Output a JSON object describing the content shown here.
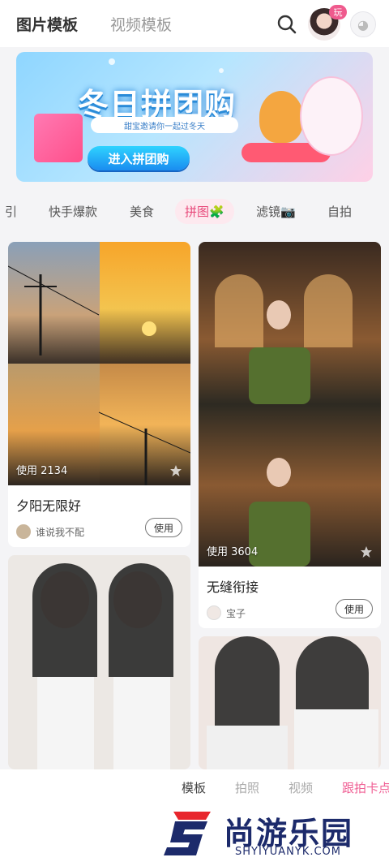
{
  "header": {
    "tabs": [
      {
        "label": "图片模板",
        "active": true
      },
      {
        "label": "视频模板",
        "active": false
      }
    ],
    "avatar_badge": "玩",
    "icons": [
      "search-icon",
      "avatar",
      "mascot-icon"
    ]
  },
  "banner": {
    "title": "冬日拼团购",
    "subtitle": "甜宝邀请你一起过冬天",
    "button": "进入拼团购"
  },
  "categories": [
    {
      "label": "引",
      "active": false
    },
    {
      "label": "快手爆款",
      "active": false
    },
    {
      "label": "美食",
      "active": false
    },
    {
      "label": "拼图🧩",
      "active": true
    },
    {
      "label": "滤镜📷",
      "active": false
    },
    {
      "label": "自拍",
      "active": false
    }
  ],
  "cards": [
    {
      "title": "夕阳无限好",
      "uses": "使用 2134",
      "author": "谁说我不配",
      "button": "使用"
    },
    {
      "title": "无缝衔接",
      "uses": "使用 3604",
      "author": "宝子",
      "button": "使用"
    },
    {
      "title": "",
      "uses": "",
      "author": "",
      "button": ""
    },
    {
      "title": "",
      "uses": "",
      "author": "",
      "button": ""
    }
  ],
  "bottom_nav": [
    {
      "label": "模板",
      "state": "active"
    },
    {
      "label": "拍照",
      "state": "inactive"
    },
    {
      "label": "视频",
      "state": "inactive"
    },
    {
      "label": "跟拍卡点",
      "state": "hot"
    }
  ],
  "watermark": {
    "brand": "尚游乐园",
    "url": "SHYIYUANYK.COM"
  },
  "colors": {
    "accent_pink": "#e84a7b",
    "banner_button": "#1a8cf0",
    "watermark_navy": "#1c2a6b",
    "watermark_red": "#e8262d"
  }
}
